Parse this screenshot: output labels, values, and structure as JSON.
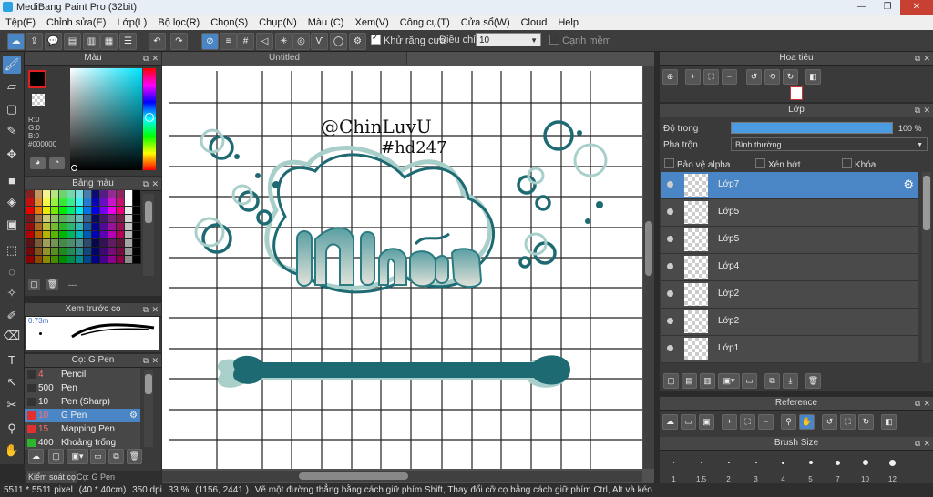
{
  "window": {
    "title": "MediBang Paint Pro (32bit)"
  },
  "menu": [
    "Tệp(F)",
    "Chỉnh sửa(E)",
    "Lớp(L)",
    "Bộ lọc(R)",
    "Chọn(S)",
    "Chụp(N)",
    "Màu (C)",
    "Xem(V)",
    "Công cụ(T)",
    "Cửa sổ(W)",
    "Cloud",
    "Help"
  ],
  "toolbar": {
    "antialias_label": "Khử răng cưa",
    "adjust_label": "Điều chỉnh",
    "adjust_value": "10",
    "blur_label": "Cạnh mềm"
  },
  "color_panel": {
    "title": "Màu",
    "r": "R:0",
    "g": "G:0",
    "b": "B:0",
    "hex": "#000000"
  },
  "palette_panel": {
    "title": "Bảng màu",
    "footer": "---"
  },
  "brush_preview": {
    "title": "Xem trước cọ",
    "size": "0.73m"
  },
  "brush_panel": {
    "title": "Cọ: G Pen",
    "items": [
      {
        "size": "4",
        "name": "Pencil",
        "color": "#333333"
      },
      {
        "size": "500",
        "name": "Pen",
        "color": "#333333"
      },
      {
        "size": "10",
        "name": "Pen (Sharp)",
        "color": "#333333"
      },
      {
        "size": "10",
        "name": "G Pen",
        "color": "#e03030"
      },
      {
        "size": "15",
        "name": "Mapping Pen",
        "color": "#e03030"
      },
      {
        "size": "400",
        "name": "Khoảng trống [Edge]",
        "color": "#2db52d"
      }
    ]
  },
  "bottom_tabs": [
    "Kiểm soát cọ",
    "Cọ: G Pen"
  ],
  "document": {
    "tab": "Untitled",
    "signature_line1": "@ChinLuvU",
    "signature_line2": "#hd247"
  },
  "navigator": {
    "title": "Hoa tiêu"
  },
  "layer_panel": {
    "title": "Lớp",
    "opacity_label": "Độ trong",
    "opacity_value": "100 %",
    "blend_label": "Pha trộn",
    "blend_value": "Bình thường",
    "protect_alpha": "Bảo vệ alpha",
    "clipping": "Xén bớt",
    "lock": "Khóa",
    "layers": [
      "Lớp7",
      "Lớp5",
      "Lớp5",
      "Lớp4",
      "Lớp2",
      "Lớp2",
      "Lớp1"
    ]
  },
  "reference_panel": {
    "title": "Reference"
  },
  "brush_size_panel": {
    "title": "Brush Size",
    "sizes": [
      "1",
      "1.5",
      "2",
      "3",
      "4",
      "5",
      "7",
      "10",
      "12"
    ]
  },
  "status": {
    "size": "5511 * 5511 pixel",
    "cm": "(40 * 40cm)",
    "dpi": "350 dpi",
    "zoom": "33 %",
    "coords": "(1156, 2441 )",
    "hint": "Vẽ một đường thẳng bằng cách giữ phím Shift, Thay đổi cỡ cọ bằng cách giữ phím Ctrl, Alt và kéo"
  },
  "colors": {
    "accent": "#4a86c5",
    "teal_dark": "#1d6a73",
    "teal_light": "#a9cfcb"
  }
}
